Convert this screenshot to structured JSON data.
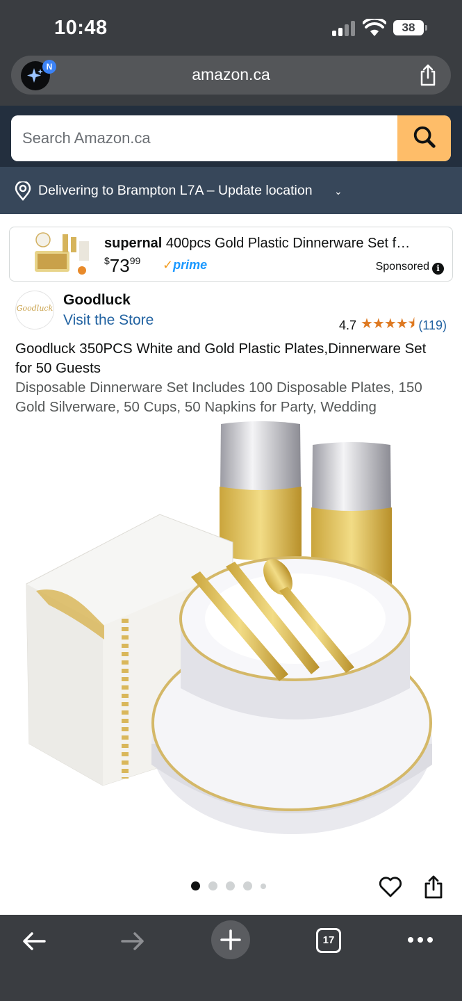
{
  "status_bar": {
    "time": "10:48",
    "battery": "38"
  },
  "browser": {
    "url": "amazon.ca",
    "ai_badge": "N"
  },
  "search": {
    "placeholder": "Search Amazon.ca"
  },
  "delivery": {
    "text": "Delivering to Brampton L7A – Update location"
  },
  "sponsored": {
    "brand": "supernal",
    "title": "400pcs Gold Plastic Dinnerware Set f…",
    "price_symbol": "$",
    "price_whole": "73",
    "price_fraction": "99",
    "prime_label": "prime",
    "label": "Sponsored",
    "info_icon": "i"
  },
  "product": {
    "brand": "Goodluck",
    "store_logo_text": "Goodluck",
    "visit_store": "Visit the Store",
    "rating": "4.7",
    "stars_glyph": "★★★★⯨",
    "rating_value": 4.7,
    "review_count": "(119)",
    "title": "Goodluck 350PCS White and Gold Plastic Plates,Dinnerware Set for 50 Guests",
    "subtitle": "Disposable Dinnerware Set Includes 100 Disposable Plates, 150 Gold Silverware, 50 Cups, 50 Napkins for Party, Wedding"
  },
  "carousel": {
    "image_count": 5,
    "active_index": 0
  },
  "toolbar": {
    "tab_count": "17"
  },
  "colors": {
    "chrome": "#3a3d41",
    "amazon_header": "#232f3e",
    "delivery_bar": "#37475a",
    "search_button": "#febd69",
    "link": "#2162a1",
    "star": "#de7921",
    "prime": "#1a98ff"
  },
  "icons": [
    "ai-sparkle-icon",
    "share-icon",
    "search-icon",
    "location-pin-icon",
    "info-icon",
    "heart-icon",
    "back-arrow-icon",
    "forward-arrow-icon",
    "plus-icon",
    "tabs-icon",
    "more-icon"
  ]
}
